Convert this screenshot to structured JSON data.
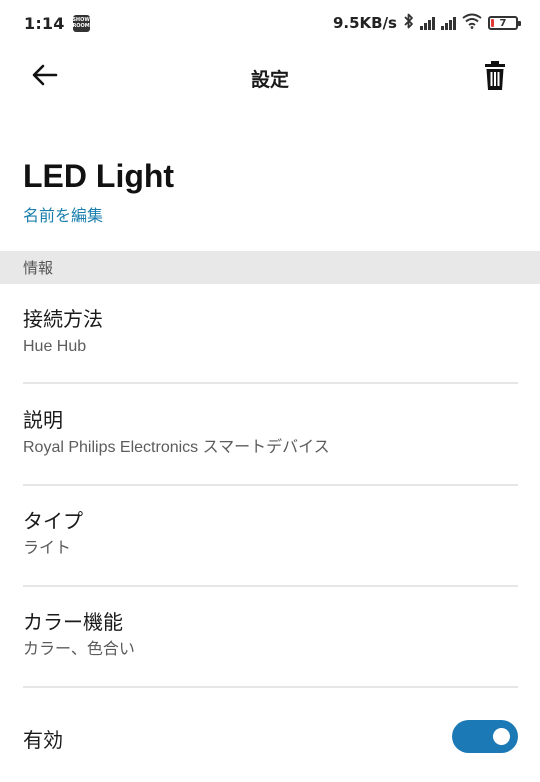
{
  "status_bar": {
    "time": "1:14",
    "showroom_label": "SHOW ROOM",
    "network_speed": "9.5KB/s",
    "battery_level": "7"
  },
  "app_bar": {
    "title": "設定"
  },
  "device": {
    "name": "LED Light",
    "edit_name_label": "名前を編集"
  },
  "section": {
    "info_label": "情報"
  },
  "rows": [
    {
      "title": "接続方法",
      "value": "Hue Hub"
    },
    {
      "title": "説明",
      "value": "Royal Philips Electronics スマートデバイス"
    },
    {
      "title": "タイプ",
      "value": "ライト"
    },
    {
      "title": "カラー機能",
      "value": "カラー、色合い"
    }
  ],
  "enabled": {
    "label": "有効",
    "state": true
  },
  "colors": {
    "accent": "#1b79b5",
    "link": "#1a7fae",
    "section_bg": "#e8e8e8",
    "battery_low": "#e53935"
  }
}
